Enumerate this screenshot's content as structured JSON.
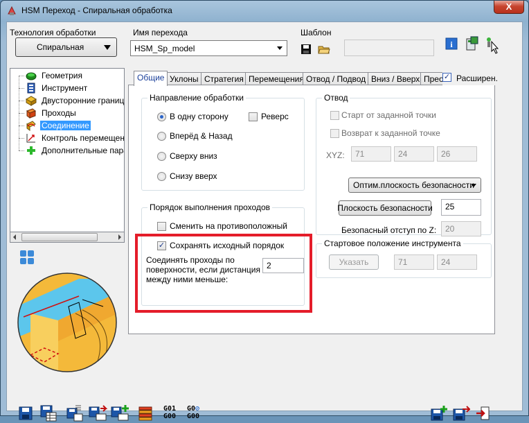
{
  "window": {
    "title": "HSM Переход - Спиральная обработка",
    "close_label": "X"
  },
  "header": {
    "tech_label": "Технология обработки",
    "tech_value": "Спиральная",
    "name_label": "Имя перехода",
    "name_value": "HSM_Sp_model",
    "template_label": "Шаблон"
  },
  "tree": {
    "items": [
      {
        "label": "Геометрия",
        "icon": "geometry-icon"
      },
      {
        "label": "Инструмент",
        "icon": "tool-icon"
      },
      {
        "label": "Двусторонние границы",
        "icon": "boundaries-icon"
      },
      {
        "label": "Проходы",
        "icon": "passes-icon"
      },
      {
        "label": "Соединение",
        "icon": "link-icon",
        "selected": true
      },
      {
        "label": "Контроль перемещений",
        "icon": "motion-control-icon"
      },
      {
        "label": "Дополнительные параметры",
        "icon": "add-params-icon"
      }
    ]
  },
  "tabs": [
    "Общие",
    "Уклоны",
    "Стратегия",
    "Перемещения",
    "Отвод / Подвод",
    "Вниз / Вверх",
    "Прео"
  ],
  "advanced_label": "Расширен.",
  "direction": {
    "title": "Направление обработки",
    "options": [
      "В одну сторону",
      "Вперёд & Назад",
      "Сверху вниз",
      "Снизу вверх"
    ],
    "selected": 0,
    "reverse_label": "Реверс"
  },
  "order": {
    "title": "Порядок выполнения проходов",
    "change_opposite": "Сменить на противоположный",
    "keep_original": "Сохранять исходный порядок",
    "connect_text_1": "Соединять проходы по",
    "connect_text_2": "поверхности, если дистанция",
    "connect_text_3": "между ними меньше:",
    "connect_value": "2"
  },
  "retract": {
    "title": "Отвод",
    "start_from_point": "Старт от заданной точки",
    "return_to_point": "Возврат к заданной точке",
    "xyz_label": "XYZ:",
    "xyz": [
      "71",
      "24",
      "26"
    ],
    "clearance_mode": "Оптим.плоскость безопасности",
    "clearance_plane_btn": "Плоскость безопасности",
    "clearance_value": "25",
    "safe_offset_label": "Безопасный отступ по Z:",
    "safe_offset_value": "20"
  },
  "start_position": {
    "title": "Стартовое положение инструмента",
    "specify_btn": "Указать",
    "x": "71",
    "y": "24"
  },
  "bottom_toolbar": {
    "gcode_1a": "G01",
    "gcode_1b": "G00",
    "gcode_2a": "G0",
    "gcode_2b": "G00"
  },
  "colors": {
    "accent": "#e41d2a",
    "selection": "#3399ff",
    "tab_active_text": "#1a3f9a"
  }
}
